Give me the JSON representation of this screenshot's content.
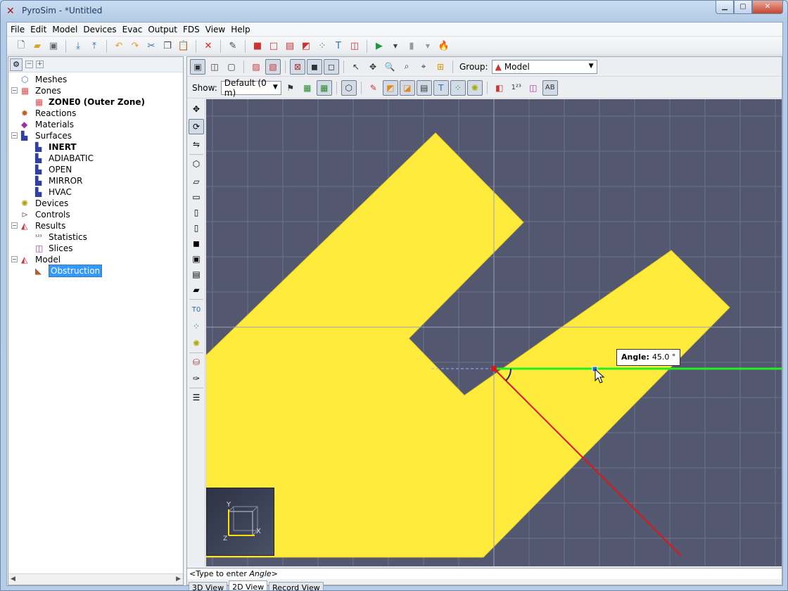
{
  "window": {
    "title": "PyroSim - *Untitled",
    "controls": {
      "minimize": "▁",
      "maximize": "▢",
      "close": "✕"
    }
  },
  "menu": [
    "File",
    "Edit",
    "Model",
    "Devices",
    "Evac",
    "Output",
    "FDS",
    "View",
    "Help"
  ],
  "tree": {
    "nodes": [
      {
        "label": "Meshes",
        "icon": "mesh-icon",
        "level": 0,
        "expander": ""
      },
      {
        "label": "Zones",
        "icon": "zone-icon",
        "level": 0,
        "expander": "−"
      },
      {
        "label": "ZONE0 (Outer Zone)",
        "icon": "zone-icon",
        "level": 1,
        "bold": true
      },
      {
        "label": "Reactions",
        "icon": "reaction-icon",
        "level": 0,
        "expander": ""
      },
      {
        "label": "Materials",
        "icon": "material-icon",
        "level": 0,
        "expander": ""
      },
      {
        "label": "Surfaces",
        "icon": "surface-icon",
        "level": 0,
        "expander": "−"
      },
      {
        "label": "INERT",
        "icon": "surface-icon",
        "level": 1,
        "bold": true
      },
      {
        "label": "ADIABATIC",
        "icon": "surface-icon",
        "level": 1
      },
      {
        "label": "OPEN",
        "icon": "surface-icon",
        "level": 1
      },
      {
        "label": "MIRROR",
        "icon": "surface-icon",
        "level": 1
      },
      {
        "label": "HVAC",
        "icon": "surface-icon",
        "level": 1
      },
      {
        "label": "Devices",
        "icon": "device-icon",
        "level": 0,
        "expander": ""
      },
      {
        "label": "Controls",
        "icon": "control-icon",
        "level": 0,
        "expander": ""
      },
      {
        "label": "Results",
        "icon": "result-icon",
        "level": 0,
        "expander": "−"
      },
      {
        "label": "Statistics",
        "icon": "statistics-icon",
        "level": 1
      },
      {
        "label": "Slices",
        "icon": "slice-icon",
        "level": 1
      },
      {
        "label": "Model",
        "icon": "model-icon",
        "level": 0,
        "expander": "−"
      },
      {
        "label": "Obstruction",
        "icon": "obstruction-icon",
        "level": 1,
        "selected": true
      }
    ]
  },
  "view_toolbar": {
    "group_label": "Group:",
    "group_value": "Model",
    "show_label": "Show:",
    "show_value": "Default (0 m)"
  },
  "canvas": {
    "tooltip_label": "Angle:",
    "tooltip_value": "45.0 °",
    "axis_x": "X",
    "axis_y": "Y",
    "axis_z": "Z",
    "colors": {
      "background": "#535870",
      "obstruction": "#ffeb3b",
      "grid": "#6e7389",
      "guide_green": "#22ee22",
      "guide_red": "#e0141a"
    }
  },
  "command_line": {
    "prefix": "<Type to enter ",
    "emph": "Angle",
    "suffix": ">"
  },
  "view_tabs": [
    "3D View",
    "2D View",
    "Record View"
  ],
  "active_view_tab": "2D View"
}
